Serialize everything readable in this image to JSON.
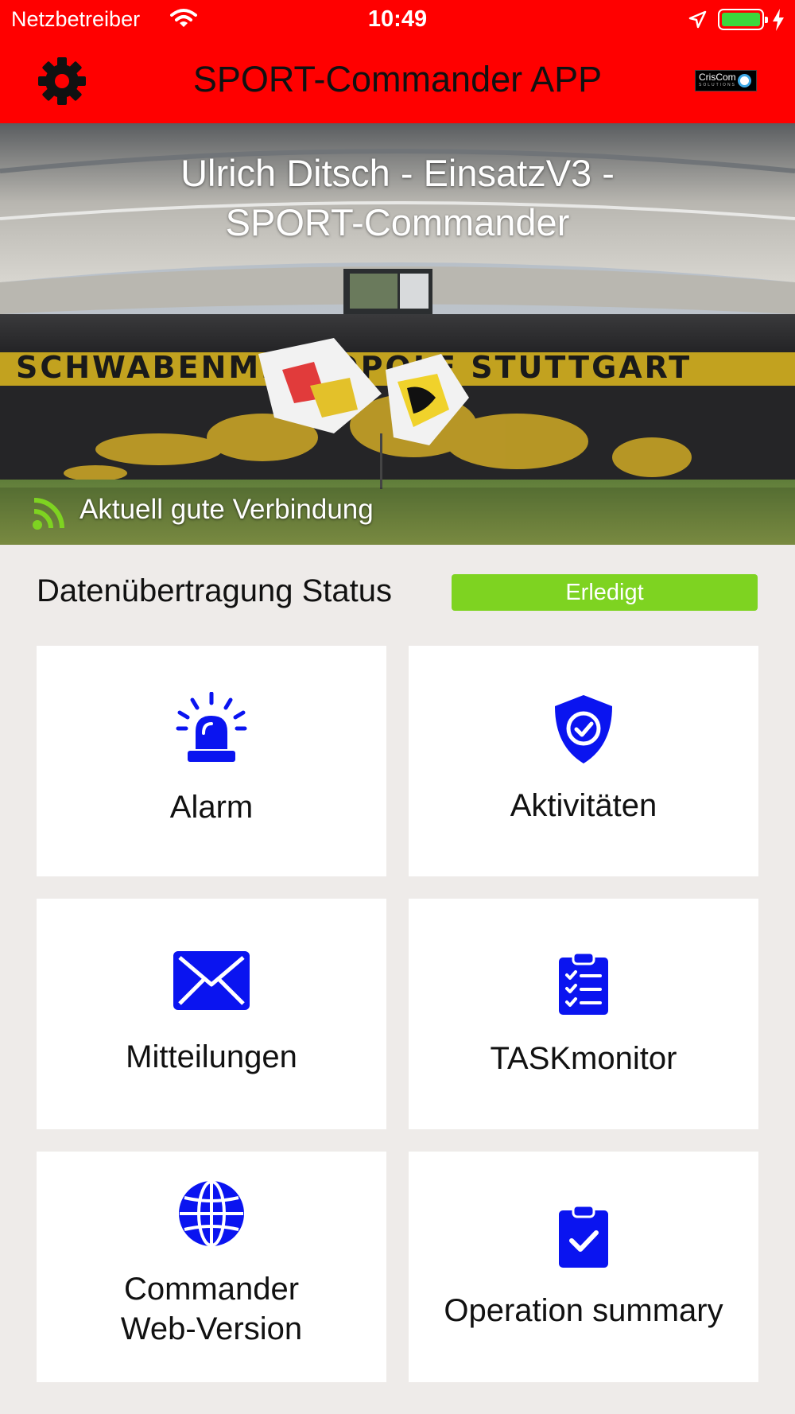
{
  "status_bar": {
    "carrier": "Netzbetreiber",
    "time": "10:49"
  },
  "header": {
    "title": "SPORT-Commander APP",
    "logo_text": "CrisCom",
    "logo_subtext": "SOLUTIONS"
  },
  "hero": {
    "title_line1": "Ulrich Ditsch - EinsatzV3 -",
    "title_line2": "SPORT-Commander",
    "connection_text": "Aktuell gute Verbindung"
  },
  "sync": {
    "label": "Datenübertragung Status",
    "status": "Erledigt",
    "status_color": "#7ed321"
  },
  "tiles": [
    {
      "label": "Alarm",
      "icon": "siren-icon"
    },
    {
      "label": "Aktivitäten",
      "icon": "shield-check-icon"
    },
    {
      "label": "Mitteilungen",
      "icon": "envelope-icon"
    },
    {
      "label": "TASKmonitor",
      "icon": "clipboard-list-icon"
    },
    {
      "label_line1": "Commander",
      "label_line2": "Web-Version",
      "icon": "globe-icon"
    },
    {
      "label": "Operation summary",
      "icon": "clipboard-check-icon"
    }
  ],
  "colors": {
    "header_bg": "#ff0000",
    "icon_blue": "#0a14f0",
    "connection_green": "#7ed321"
  }
}
